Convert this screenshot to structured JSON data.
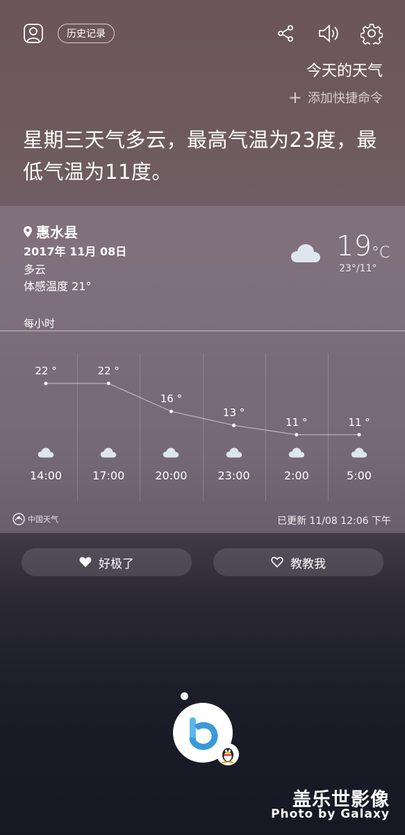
{
  "header": {
    "history_label": "历史记录",
    "icons": [
      "profile-icon",
      "share-icon",
      "volume-icon",
      "settings-icon"
    ]
  },
  "query": {
    "title": "今天的天气",
    "add_shortcut": "添加快捷命令"
  },
  "answer": "星期三天气多云，最高气温为23度，最低气温为11度。",
  "weather": {
    "location": "惠水县",
    "date": "2017年 11月 08日",
    "condition": "多云",
    "feels_like": "体感温度 21°",
    "current_temp": "19",
    "current_unit": "°C",
    "range": "23°/11°",
    "hourly_label": "每小时",
    "hourly": [
      {
        "time": "14:00",
        "temp": "22 °",
        "value": 22
      },
      {
        "time": "17:00",
        "temp": "22 °",
        "value": 22
      },
      {
        "time": "20:00",
        "temp": "16 °",
        "value": 16
      },
      {
        "time": "23:00",
        "temp": "13 °",
        "value": 13
      },
      {
        "time": "2:00",
        "temp": "11 °",
        "value": 11
      },
      {
        "time": "5:00",
        "temp": "11 °",
        "value": 11
      }
    ],
    "provider": "中国天气",
    "updated": "已更新  11/08 12:06 下午"
  },
  "feedback": {
    "great_label": "好极了",
    "teach_label": "教教我"
  },
  "watermark": {
    "line1": "盖乐世影像",
    "line2": "Photo by Galaxy"
  },
  "colors": {
    "cloud": "#dde6ee",
    "bixby_blue": "#4aa8e0"
  }
}
